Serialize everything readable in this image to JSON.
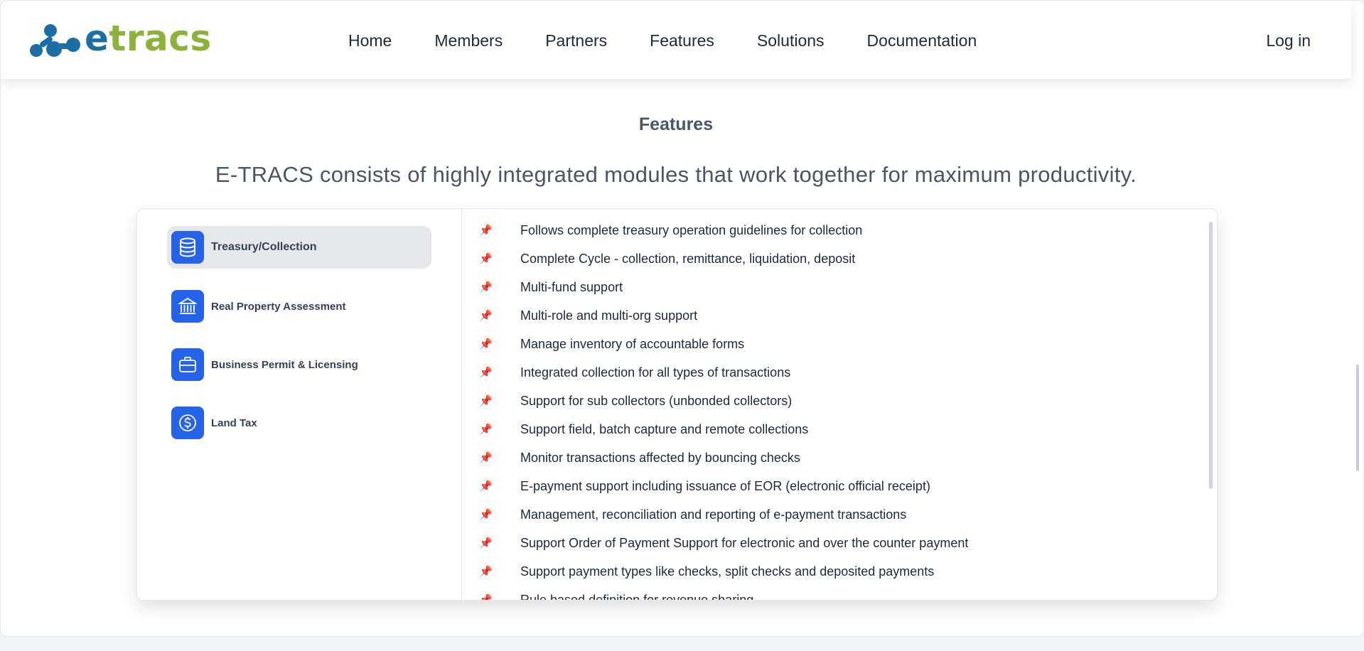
{
  "brand": {
    "logo_e": "e",
    "logo_rest": "tracs",
    "color_e": "#1d6ea5",
    "color_rest": "#8db13b"
  },
  "nav": {
    "items": [
      "Home",
      "Members",
      "Partners",
      "Features",
      "Solutions",
      "Documentation"
    ],
    "login": "Log in"
  },
  "section": {
    "label": "Features",
    "subtitle": "E-TRACS consists of highly integrated modules that work together for maximum productivity."
  },
  "modules": [
    {
      "label": "Treasury/Collection",
      "icon": "database-icon",
      "active": true
    },
    {
      "label": "Real Property Assessment",
      "icon": "bank-icon",
      "active": false
    },
    {
      "label": "Business Permit & Licensing",
      "icon": "briefcase-icon",
      "active": false
    },
    {
      "label": "Land Tax",
      "icon": "dollar-circle-icon",
      "active": false
    }
  ],
  "features": {
    "bullet_icon": "pushpin-icon",
    "items": [
      "Follows complete treasury operation guidelines for collection",
      "Complete Cycle - collection, remittance, liquidation, deposit",
      "Multi-fund support",
      "Multi-role and multi-org support",
      "Manage inventory of accountable forms",
      "Integrated collection for all types of transactions",
      "Support for sub collectors (unbonded collectors)",
      "Support field, batch capture and remote collections",
      "Monitor transactions affected by bouncing checks",
      "E-payment support including issuance of EOR (electronic official receipt)",
      "Management, reconciliation and reporting of e-payment transactions",
      "Support Order of Payment Support for electronic and over the counter payment",
      "Support payment types like checks, split checks and deposited payments",
      "Rule based definition for revenue sharing"
    ]
  },
  "colors": {
    "accent": "#2563eb",
    "pin": "#dc2626",
    "active_bg": "#e5e7eb"
  }
}
